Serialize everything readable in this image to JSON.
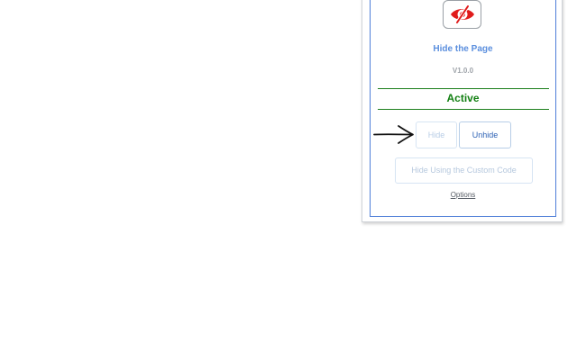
{
  "extension": {
    "name": "Hide the Page",
    "version": "V1.0.0",
    "logo_icon": "eye-slash-icon",
    "logo_color": "#e01b1b"
  },
  "status": {
    "text": "Active",
    "color": "#138013"
  },
  "buttons": {
    "hide_label": "Hide",
    "unhide_label": "Unhide",
    "custom_label": "Hide Using the Custom Code"
  },
  "links": {
    "options_label": "Options"
  },
  "annotation": {
    "icon": "arrow-right-icon",
    "target": "hide-button"
  },
  "colors": {
    "panel_border": "#4f7fd8",
    "name_text": "#5b8fde",
    "primary_button_text": "#2f63b5"
  }
}
